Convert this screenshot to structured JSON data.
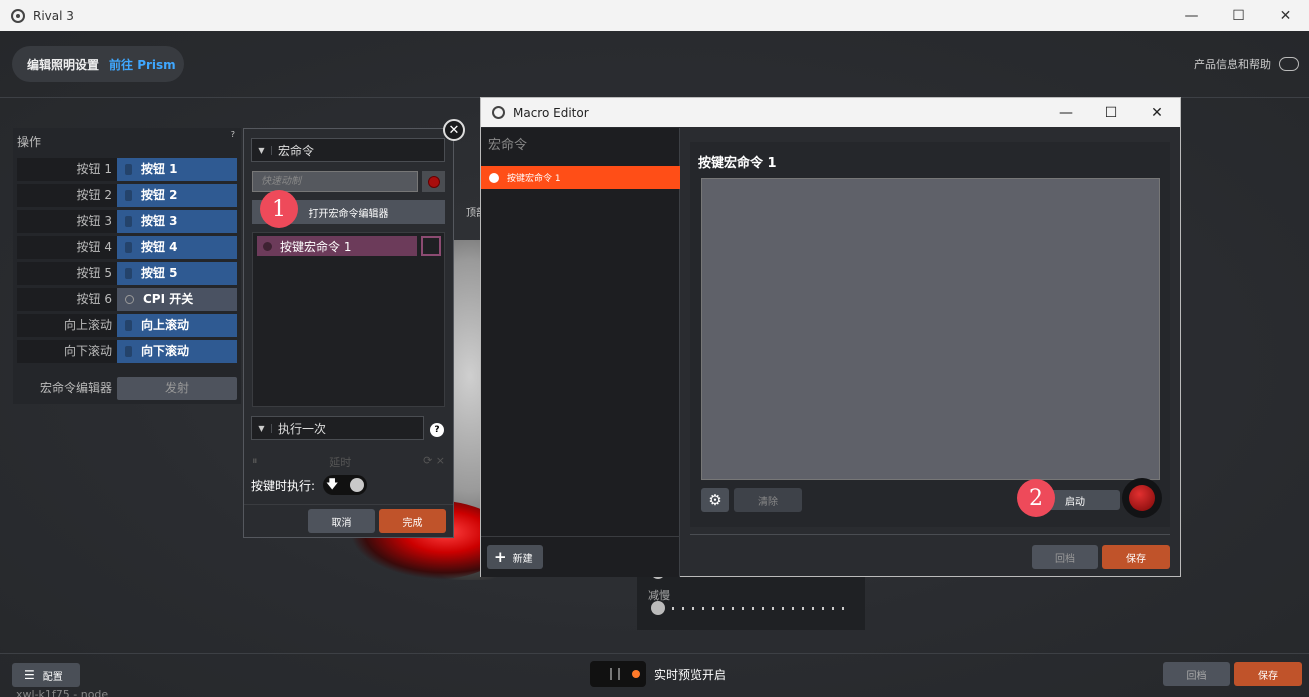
{
  "app": {
    "title": "Rival 3",
    "window_buttons": [
      "—",
      "☐",
      "✕"
    ]
  },
  "topbar": {
    "label": "编辑照明设置",
    "link": "前往 Prism"
  },
  "help": {
    "label": "产品信息和帮助"
  },
  "left_panel": {
    "header": "操作",
    "help_mark": "?",
    "rows": [
      {
        "label": "按钮 1",
        "value": "按钮 1"
      },
      {
        "label": "按钮 2",
        "value": "按钮 2"
      },
      {
        "label": "按钮 3",
        "value": "按钮 3"
      },
      {
        "label": "按钮 4",
        "value": "按钮 4"
      },
      {
        "label": "按钮 5",
        "value": "按钮 5"
      },
      {
        "label": "按钮 6",
        "value": "CPI 开关"
      },
      {
        "label": "向上滚动",
        "value": "向上滚动"
      },
      {
        "label": "向下滚动",
        "value": "向下滚动"
      }
    ],
    "macro_row": {
      "label": "宏命令编辑器",
      "value": "发射"
    }
  },
  "popup": {
    "close": "✕",
    "type_select": "宏命令",
    "record_placeholder": "快速动制",
    "open_editor": "打开宏命令编辑器",
    "macro_item": "按键宏命令 1",
    "exec_select": "执行一次",
    "exec_help": "?",
    "icons": [
      "⏸",
      "延时",
      "⟳ ×"
    ],
    "press_label": "按键时执行:",
    "press_arrow": "🡇",
    "cancel": "取消",
    "done": "完成"
  },
  "badges": {
    "one": "1",
    "two": "2"
  },
  "background": {
    "top_label": "顶部",
    "slow_label": "减慢"
  },
  "macro_editor": {
    "title": "Macro Editor",
    "window_buttons": [
      "—",
      "☐",
      "✕"
    ],
    "sidebar_header": "宏命令",
    "sidebar_item": "按键宏命令 1",
    "new_button": "新建",
    "main_title": "按键宏命令 1",
    "gear": "⚙",
    "clear": "清除",
    "start": "启动",
    "revert": "回档",
    "save": "保存"
  },
  "footer": {
    "config": "配置",
    "config_icon": "☰",
    "preview": "实时预览开启",
    "revert": "回档",
    "save": "保存",
    "bottom_text": "xwl-k1f75 - node"
  },
  "colors": {
    "accent_orange": "#ff4e17",
    "save_orange": "#c0532a",
    "button_blue": "#2f5a92",
    "badge_pink": "#ee4a5a"
  }
}
